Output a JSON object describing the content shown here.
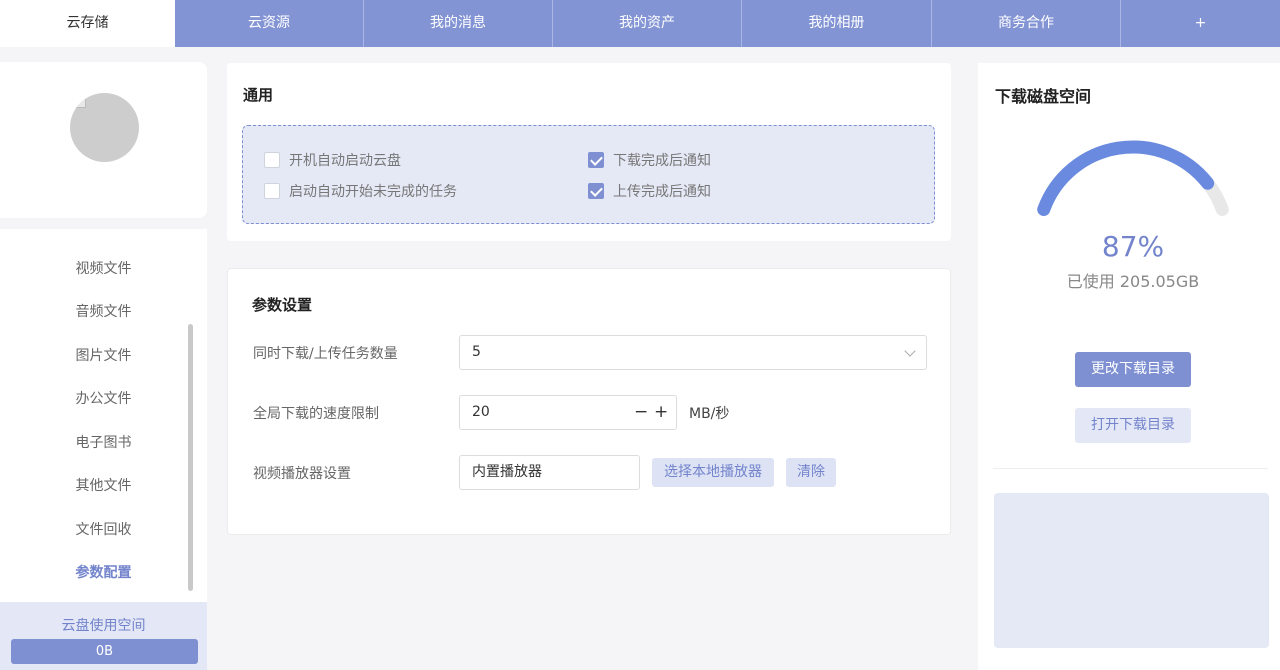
{
  "tabs": [
    {
      "label": "云存储"
    },
    {
      "label": "云资源"
    },
    {
      "label": "我的消息"
    },
    {
      "label": "我的资产"
    },
    {
      "label": "我的相册"
    },
    {
      "label": "商务合作"
    },
    {
      "label": "+"
    }
  ],
  "sidebar": {
    "menu": [
      {
        "label": "视频文件"
      },
      {
        "label": "音频文件"
      },
      {
        "label": "图片文件"
      },
      {
        "label": "办公文件"
      },
      {
        "label": "电子图书"
      },
      {
        "label": "其他文件"
      },
      {
        "label": "文件回收"
      },
      {
        "label": "参数配置"
      }
    ],
    "usage_label": "云盘使用空间",
    "usage_value": "0B"
  },
  "general": {
    "title": "通用",
    "options": [
      {
        "label": "开机自动启动云盘",
        "checked": false
      },
      {
        "label": "下载完成后通知",
        "checked": true
      },
      {
        "label": "启动自动开始未完成的任务",
        "checked": false
      },
      {
        "label": "上传完成后通知",
        "checked": true
      }
    ]
  },
  "params": {
    "title": "参数设置",
    "concurrent_label": "同时下载/上传任务数量",
    "concurrent_value": "5",
    "speed_label": "全局下载的速度限制",
    "speed_value": "20",
    "speed_minus": "−",
    "speed_plus": "+",
    "speed_unit": "MB/秒",
    "player_label": "视频播放器设置",
    "player_value": "内置播放器",
    "choose_player": "选择本地播放器",
    "clear": "清除"
  },
  "disk": {
    "title": "下载磁盘空间",
    "percent_text": "87%",
    "percent": 0.87,
    "used_text": "已使用 205.05GB",
    "change_dir": "更改下载目录",
    "open_dir": "打开下载目录"
  },
  "colors": {
    "accent": "#7e90d2",
    "tab_bar": "#8394d4",
    "gauge_track": "#e8e8e8",
    "gauge_fill": "#6a8ae0"
  }
}
